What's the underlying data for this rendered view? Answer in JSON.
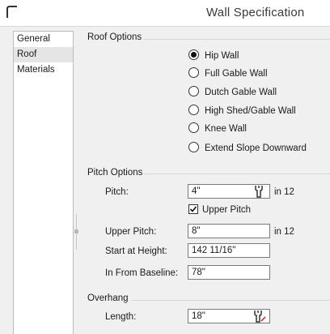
{
  "window": {
    "title": "Wall Specification"
  },
  "sidebar": {
    "items": [
      {
        "label": "General"
      },
      {
        "label": "Roof"
      },
      {
        "label": "Materials"
      }
    ]
  },
  "roof_options": {
    "heading": "Roof Options",
    "options": [
      {
        "label": "Hip Wall",
        "selected": true
      },
      {
        "label": "Full Gable Wall",
        "selected": false
      },
      {
        "label": "Dutch Gable Wall",
        "selected": false
      },
      {
        "label": "High Shed/Gable Wall",
        "selected": false
      },
      {
        "label": "Knee Wall",
        "selected": false
      },
      {
        "label": "Extend Slope Downward",
        "selected": false
      }
    ]
  },
  "pitch_options": {
    "heading": "Pitch Options",
    "pitch_label": "Pitch:",
    "pitch_value": "4\"",
    "pitch_suffix": "in 12",
    "upper_pitch_checkbox_label": "Upper Pitch",
    "upper_pitch_checked": true,
    "upper_pitch_label": "Upper Pitch:",
    "upper_pitch_value": "8\"",
    "upper_pitch_suffix": "in 12",
    "start_height_label": "Start at Height:",
    "start_height_value": "142 11/16\"",
    "baseline_label": "In From Baseline:",
    "baseline_value": "78\""
  },
  "overhang": {
    "heading": "Overhang",
    "length_label": "Length:",
    "length_value": "18\""
  }
}
